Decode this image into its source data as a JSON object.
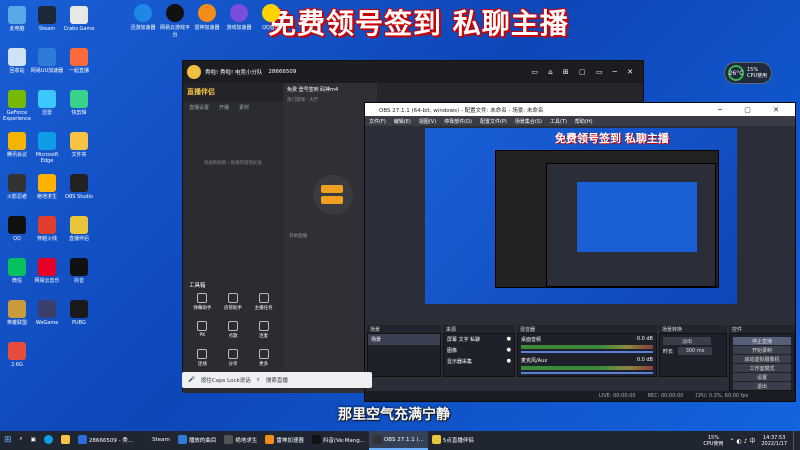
{
  "overlay_title": "免费领号签到 私聊主播",
  "subtitle": "那里空气充满宁静",
  "top_icons": [
    {
      "label": "迅游加速器",
      "color": "#1e88e5"
    },
    {
      "label": "网易云游戏平台",
      "color": "#111"
    },
    {
      "label": "雷神加速器",
      "color": "#f28c1a"
    },
    {
      "label": "游戏加速器",
      "color": "#7b4ddc"
    },
    {
      "label": "QQ音乐",
      "color": "#ffd400"
    }
  ],
  "desktop_icons": [
    {
      "label": "此电脑",
      "color": "#5aa9e6"
    },
    {
      "label": "Steam",
      "color": "#1b2838"
    },
    {
      "label": "Crabs Game",
      "color": "#e8e8e8"
    },
    {
      "label": "回收站",
      "color": "#cfe3f7"
    },
    {
      "label": "网易UU加速器",
      "color": "#2f7bd8"
    },
    {
      "label": "一起直播",
      "color": "#ff6a3d"
    },
    {
      "label": "GeForce Experience",
      "color": "#76b900"
    },
    {
      "label": "迅雷",
      "color": "#3cc8ff"
    },
    {
      "label": "快剪辑",
      "color": "#3ad28a"
    },
    {
      "label": "腾讯会议",
      "color": "#f4b400"
    },
    {
      "label": "Microsoft Edge",
      "color": "#0f9de8"
    },
    {
      "label": "文件夹",
      "color": "#f6c344"
    },
    {
      "label": "火影忍者",
      "color": "#333"
    },
    {
      "label": "绝地求生",
      "color": "#ffb300"
    },
    {
      "label": "OBS Studio",
      "color": "#222"
    },
    {
      "label": "QQ",
      "color": "#111"
    },
    {
      "label": "穿越火线",
      "color": "#e03e2d"
    },
    {
      "label": "直播伴侣",
      "color": "#e8c53a"
    },
    {
      "label": "微信",
      "color": "#07c160"
    },
    {
      "label": "网易云音乐",
      "color": "#e60026"
    },
    {
      "label": "抖音",
      "color": "#111"
    },
    {
      "label": "英雄联盟",
      "color": "#c89b3c"
    },
    {
      "label": "WeGame",
      "color": "#3b3f6b"
    },
    {
      "label": "PUBG",
      "color": "#1a1a1a"
    },
    {
      "label": "2.6G",
      "color": "#e74c3c"
    }
  ],
  "cpu_widget": {
    "temp": "26°C",
    "usage": "15%",
    "label": "CPU使用"
  },
  "live_app": {
    "room_title": "秀啦! 秀啦! 电竞小分队",
    "room_id": "28666509",
    "app_name": "直播伴侣",
    "tabs": [
      "直播设置",
      "开播",
      "素材"
    ],
    "mid_title": "免费 登号签到 码神m4",
    "mid_tag": "热门游戏 · 大厅",
    "empty_hint": "添加新视频 / 拖拽内容到此处",
    "tools_title": "工具箱",
    "tools": [
      {
        "label": "弹幕助手"
      },
      {
        "label": "房管助手"
      },
      {
        "label": "主播任务"
      },
      {
        "label": "PK"
      },
      {
        "label": "点歌"
      },
      {
        "label": "连麦"
      },
      {
        "label": "连线"
      },
      {
        "label": "分享"
      },
      {
        "label": "更多"
      }
    ],
    "start_label": "开始直播"
  },
  "obs": {
    "title": "OBS 27.1.1 (64-bit, windows) - 配置文件: 未命名 - 场景: 未命名",
    "menus": [
      "文件(F)",
      "编辑(E)",
      "视图(V)",
      "停靠部件(D)",
      "配置文件(P)",
      "场景集合(S)",
      "工具(T)",
      "帮助(H)"
    ],
    "preview_overlay": "免费领号签到 私聊主播",
    "dock_headers": [
      "场景",
      "来源",
      "混音器",
      "场景转换",
      "控件"
    ],
    "scenes": [
      "场景"
    ],
    "sources": [
      "屏幕 文字 私聊",
      "图像",
      "显示器采集"
    ],
    "mixer": [
      {
        "label": "桌面音频",
        "db": "0.0 dB"
      },
      {
        "label": "麦克风/Aux",
        "db": "0.0 dB"
      }
    ],
    "transition": {
      "type": "淡出",
      "duration_label": "时长",
      "duration": "300 ms"
    },
    "controls": [
      "停止直播",
      "开始录制",
      "启动虚拟摄像机",
      "工作室模式",
      "设置",
      "退出"
    ],
    "status": [
      "LIVE: 00:00:00",
      "REC: 00:00:00",
      "CPU: 0.3%, 60.00 fps"
    ]
  },
  "hover_chip": {
    "caps": "按住Caps Lock说话",
    "search": "搜索直播"
  },
  "taskbar": {
    "items": [
      {
        "label": "28666509 - 秀...",
        "color": "#2d6cdf"
      },
      {
        "label": "Steam",
        "color": "#1b2838"
      },
      {
        "label": "播放的曲目",
        "color": "#2f7bd8"
      },
      {
        "label": "绝地求生",
        "color": "#555"
      },
      {
        "label": "雷神加速器",
        "color": "#f28c1a"
      },
      {
        "label": "抖音(Ve:Mang...",
        "color": "#111"
      },
      {
        "label": "OBS 27.1.1 (...",
        "color": "#333",
        "active": true
      },
      {
        "label": "5点直播伴侣",
        "color": "#e8c53a"
      }
    ],
    "cpu": "15%",
    "cpu_label": "CPU使用",
    "time": "14:37:53",
    "date": "2022/1/17"
  }
}
